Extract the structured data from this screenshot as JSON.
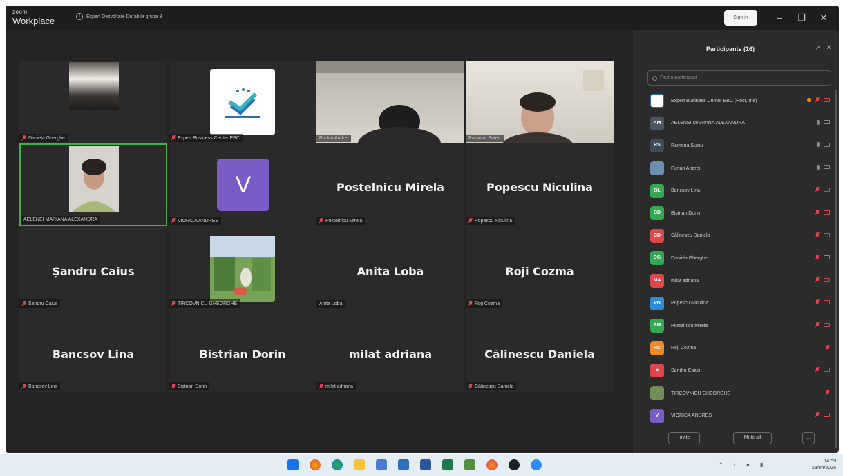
{
  "window": {
    "brand_small": "zoom",
    "brand_big": "Workplace",
    "meeting_title": "Expert Dezvoltare Durabila grupa 3",
    "sign_in": "Sign in"
  },
  "tiles": [
    {
      "name": "Daniela Gherghe",
      "big": "",
      "muted": true
    },
    {
      "name": "Expert Business Center EBC",
      "big": "",
      "muted": true
    },
    {
      "name": "Furtan Andrei",
      "big": "",
      "muted": false
    },
    {
      "name": "Ramona Suteu",
      "big": "",
      "muted": false
    },
    {
      "name": "AELENEI MARIANA ALEXANDRA",
      "big": "",
      "muted": false
    },
    {
      "name": "VIORICA ANDRES",
      "big": "",
      "muted": true
    },
    {
      "name": "Postelnicu Mirela",
      "big": "Postelnicu Mirela",
      "muted": true
    },
    {
      "name": "Popescu Niculina",
      "big": "Popescu Niculina",
      "muted": true
    },
    {
      "name": "Sandru Caius",
      "big": "Șandru Caius",
      "muted": true
    },
    {
      "name": "TIRCOVNICU GHEORGHE",
      "big": "",
      "muted": true
    },
    {
      "name": "Anita Loba",
      "big": "Anita Loba",
      "muted": false
    },
    {
      "name": "Roji Cozma",
      "big": "Roji Cozma",
      "muted": true
    },
    {
      "name": "Bancsov Lina",
      "big": "Bancsov Lina",
      "muted": true
    },
    {
      "name": "Bistrian Dorin",
      "big": "Bistrian Dorin",
      "muted": true
    },
    {
      "name": "milat adriana",
      "big": "milat adriana",
      "muted": true
    },
    {
      "name": "Călinescu Daniela",
      "big": "Călinescu Daniela",
      "muted": true
    }
  ],
  "viorica_initial": "V",
  "participants_panel": {
    "title": "Participants (16)",
    "search_placeholder": "Find a participant",
    "invite": "Invite",
    "mute_all": "Mute all",
    "more": "...",
    "items": [
      {
        "initials": "",
        "name": "Expert Business Center EBC (Host, me)",
        "color": "#ffffff",
        "mic": "off",
        "cam": "off",
        "host": true
      },
      {
        "initials": "AM",
        "name": "AELENEI MARIANA ALEXANDRA",
        "color": "#4a5661",
        "mic": "on",
        "cam": "on"
      },
      {
        "initials": "RS",
        "name": "Ramona Suteu",
        "color": "#3d4c5a",
        "mic": "on",
        "cam": "on"
      },
      {
        "initials": "",
        "name": "Furtan Andrei",
        "color": "#6a8fb0",
        "mic": "on",
        "cam": "on"
      },
      {
        "initials": "BL",
        "name": "Bancsov Lina",
        "color": "#34a853",
        "mic": "off",
        "cam": "off"
      },
      {
        "initials": "BD",
        "name": "Bistrian Dorin",
        "color": "#34a853",
        "mic": "off",
        "cam": "off"
      },
      {
        "initials": "CD",
        "name": "Călinescu Daniela",
        "color": "#e0454b",
        "mic": "off",
        "cam": "off"
      },
      {
        "initials": "DG",
        "name": "Daniela Gherghe",
        "color": "#34a853",
        "mic": "off",
        "cam": "on"
      },
      {
        "initials": "MA",
        "name": "milat adriana",
        "color": "#e0454b",
        "mic": "off",
        "cam": "off"
      },
      {
        "initials": "PN",
        "name": "Popescu Niculina",
        "color": "#2d8cd6",
        "mic": "off",
        "cam": "off"
      },
      {
        "initials": "PM",
        "name": "Postelnicu Mirela",
        "color": "#34a853",
        "mic": "off",
        "cam": "off"
      },
      {
        "initials": "RC",
        "name": "Roji Cozma",
        "color": "#f28a23",
        "mic": "off",
        "cam": "none"
      },
      {
        "initials": "S",
        "name": "Sandru Caius",
        "color": "#e0454b",
        "mic": "off",
        "cam": "off"
      },
      {
        "initials": "",
        "name": "TIRCOVNICU GHEORGHE",
        "color": "#6f8e55",
        "mic": "off",
        "cam": "none"
      },
      {
        "initials": "V",
        "name": "VIORICA ANDRES",
        "color": "#7a5cc4",
        "mic": "off",
        "cam": "off"
      }
    ]
  },
  "taskbar": {
    "time": "14:59",
    "date": "23/04/2026"
  }
}
